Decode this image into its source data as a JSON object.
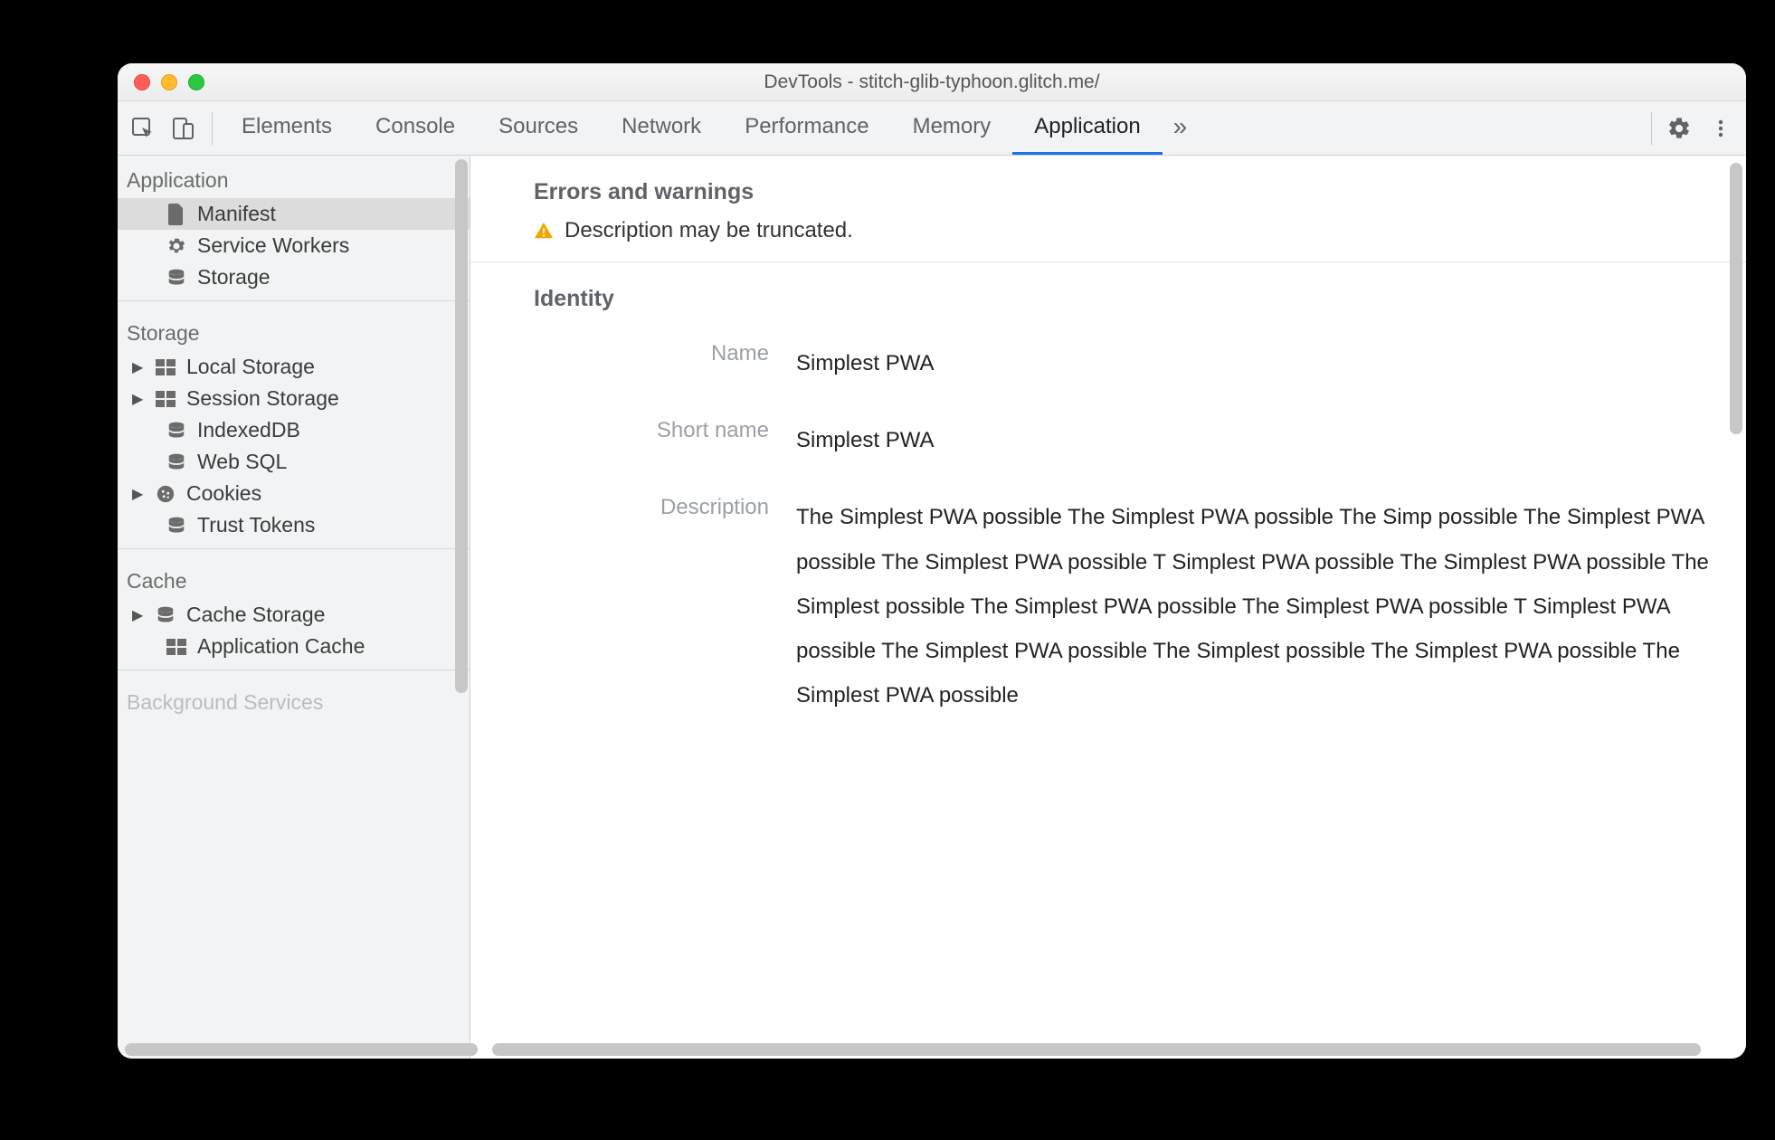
{
  "window": {
    "title": "DevTools - stitch-glib-typhoon.glitch.me/"
  },
  "toolbar": {
    "tabs": [
      {
        "label": "Elements"
      },
      {
        "label": "Console"
      },
      {
        "label": "Sources"
      },
      {
        "label": "Network"
      },
      {
        "label": "Performance"
      },
      {
        "label": "Memory"
      },
      {
        "label": "Application",
        "active": true
      }
    ],
    "overflow_glyph": "»"
  },
  "sidebar": {
    "sections": {
      "application": {
        "title": "Application",
        "items": [
          {
            "label": "Manifest",
            "icon": "file-icon",
            "selected": true
          },
          {
            "label": "Service Workers",
            "icon": "gear-icon"
          },
          {
            "label": "Storage",
            "icon": "database-icon"
          }
        ]
      },
      "storage": {
        "title": "Storage",
        "items": [
          {
            "label": "Local Storage",
            "icon": "grid-icon",
            "caret": true
          },
          {
            "label": "Session Storage",
            "icon": "grid-icon",
            "caret": true
          },
          {
            "label": "IndexedDB",
            "icon": "database-icon"
          },
          {
            "label": "Web SQL",
            "icon": "database-icon"
          },
          {
            "label": "Cookies",
            "icon": "cookie-icon",
            "caret": true
          },
          {
            "label": "Trust Tokens",
            "icon": "database-icon"
          }
        ]
      },
      "cache": {
        "title": "Cache",
        "items": [
          {
            "label": "Cache Storage",
            "icon": "database-icon",
            "caret": true
          },
          {
            "label": "Application Cache",
            "icon": "grid-icon"
          }
        ]
      },
      "background": {
        "title": "Background Services"
      }
    }
  },
  "content": {
    "errors_title": "Errors and warnings",
    "warning_text": "Description may be truncated.",
    "identity_title": "Identity",
    "identity": {
      "name_label": "Name",
      "name_value": "Simplest PWA",
      "short_name_label": "Short name",
      "short_name_value": "Simplest PWA",
      "description_label": "Description",
      "description_value": "The Simplest PWA possible The Simplest PWA possible The Simp possible The Simplest PWA possible The Simplest PWA possible T Simplest PWA possible The Simplest PWA possible The Simplest possible The Simplest PWA possible The Simplest PWA possible T Simplest PWA possible The Simplest PWA possible The Simplest possible The Simplest PWA possible The Simplest PWA possible"
    }
  },
  "colors": {
    "accent": "#1a73e8",
    "warning": "#f2a600"
  }
}
